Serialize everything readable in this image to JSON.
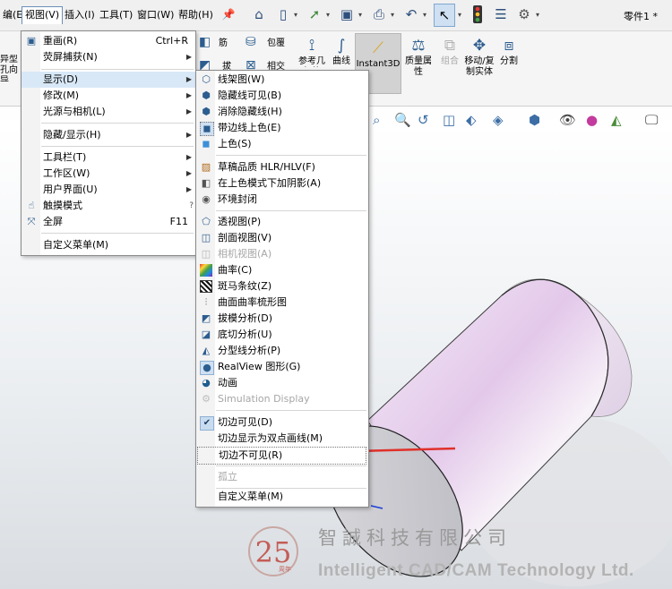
{
  "menubar": {
    "items": [
      "编(E)",
      "视图(V)",
      "插入(I)",
      "工具(T)",
      "窗口(W)",
      "帮助(H)"
    ],
    "pin_icon": "pin-icon"
  },
  "toolbar": {
    "doc_title": "零件1 *",
    "icons": [
      "home-icon",
      "new-document-icon",
      "open-icon",
      "save-icon",
      "print-icon",
      "undo-icon",
      "select-arrow-icon",
      "traffic-light-icon",
      "file-properties-icon",
      "options-gear-icon"
    ]
  },
  "ribbon": {
    "left_cut": "异型孔向导",
    "items": {
      "rib": "筋",
      "wrap": "包覆",
      "draft": "拔模",
      "intersect": "相交",
      "ref_geom": "参考几何体",
      "curves": "曲线",
      "instant3d": "Instant3D",
      "mass_props": "质量属性",
      "combine": "组合",
      "move_copy": "移动/复制实体",
      "split": "分割"
    }
  },
  "view_menu": {
    "items": [
      {
        "label": "重画(R)",
        "shortcut": "Ctrl+R",
        "icon": "redraw-icon",
        "submenu": false
      },
      {
        "label": "荧屏捕获(N)",
        "shortcut": "",
        "icon": "",
        "submenu": true
      },
      {
        "label": "显示(D)",
        "shortcut": "",
        "icon": "",
        "submenu": true
      },
      {
        "label": "修改(M)",
        "shortcut": "",
        "icon": "",
        "submenu": true
      },
      {
        "label": "光源与相机(L)",
        "shortcut": "",
        "icon": "",
        "submenu": true
      },
      {
        "label": "隐藏/显示(H)",
        "shortcut": "",
        "icon": "",
        "submenu": true
      },
      {
        "label": "工具栏(T)",
        "shortcut": "",
        "icon": "",
        "submenu": true
      },
      {
        "label": "工作区(W)",
        "shortcut": "",
        "icon": "",
        "submenu": true
      },
      {
        "label": "用户界面(U)",
        "shortcut": "",
        "icon": "",
        "submenu": true
      },
      {
        "label": "触摸模式",
        "shortcut": "",
        "icon": "touch-icon",
        "submenu": false
      },
      {
        "label": "全屏",
        "shortcut": "F11",
        "icon": "fullscreen-icon",
        "submenu": false
      },
      {
        "label": "自定义菜单(M)",
        "shortcut": "",
        "icon": "",
        "submenu": false
      }
    ]
  },
  "display_menu": {
    "items": [
      {
        "label": "线架图(W)",
        "icon": "wireframe-icon"
      },
      {
        "label": "隐藏线可见(B)",
        "icon": "hidden-lines-visible-icon"
      },
      {
        "label": "消除隐藏线(H)",
        "icon": "hidden-lines-removed-icon"
      },
      {
        "label": "带边线上色(E)",
        "icon": "shaded-with-edges-icon"
      },
      {
        "label": "上色(S)",
        "icon": "shaded-icon"
      },
      {
        "label": "草稿品质 HLR/HLV(F)",
        "icon": "draft-quality-icon"
      },
      {
        "label": "在上色模式下加阴影(A)",
        "icon": "shadows-icon"
      },
      {
        "label": "环境封闭",
        "icon": "ambient-occlusion-icon"
      },
      {
        "label": "透视图(P)",
        "icon": "perspective-icon"
      },
      {
        "label": "剖面视图(V)",
        "icon": "section-view-icon"
      },
      {
        "label": "相机视图(A)",
        "icon": "camera-view-icon"
      },
      {
        "label": "曲率(C)",
        "icon": "curvature-icon"
      },
      {
        "label": "斑马条纹(Z)",
        "icon": "zebra-stripes-icon"
      },
      {
        "label": "曲面曲率梳形图",
        "icon": "curvature-comb-icon"
      },
      {
        "label": "拔模分析(D)",
        "icon": "draft-analysis-icon"
      },
      {
        "label": "底切分析(U)",
        "icon": "undercut-analysis-icon"
      },
      {
        "label": "分型线分析(P)",
        "icon": "parting-line-icon"
      },
      {
        "label": "RealView 图形(G)",
        "icon": "realview-icon"
      },
      {
        "label": "动画",
        "icon": "animation-icon"
      },
      {
        "label": "Simulation Display",
        "icon": "simulation-icon"
      },
      {
        "label": "切边可见(D)",
        "icon": "check-icon"
      },
      {
        "label": "切边显示为双点画线(M)",
        "icon": ""
      },
      {
        "label": "切边不可见(R)",
        "icon": ""
      },
      {
        "label": "孤立",
        "icon": ""
      },
      {
        "label": "自定义菜单(M)",
        "icon": ""
      }
    ]
  },
  "watermark": {
    "cn": "智誠科技有限公司",
    "en": "Intelligent CAD/CAM Technology Ltd.",
    "logo_number": "25",
    "logo_caption": "周年"
  },
  "colors": {
    "menu_highlight": "#d8e8f7",
    "annotation_arrow": "#e0302a",
    "model_tint": "#e8d4ec",
    "logo_red": "#c0473f"
  }
}
